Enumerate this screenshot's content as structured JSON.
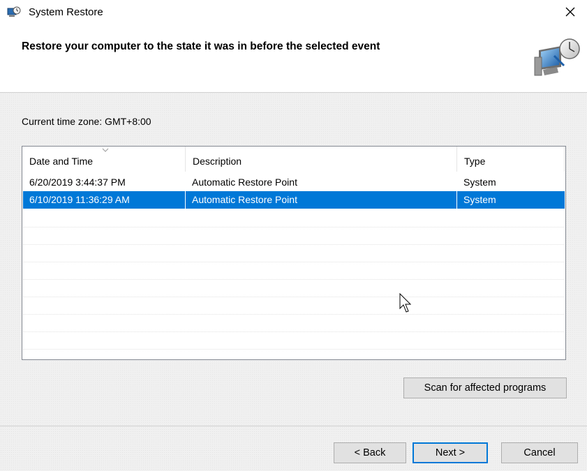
{
  "window": {
    "title": "System Restore",
    "close_glyph": "✕",
    "icons": {
      "app": "system-restore-icon",
      "close": "close-icon"
    }
  },
  "header": {
    "title": "Restore your computer to the state it was in before the selected event",
    "logo_icon": "system-restore-logo-icon"
  },
  "content": {
    "timezone_label": "Current time zone: GMT+8:00"
  },
  "restore_points": {
    "columns": [
      {
        "label": "Date and Time"
      },
      {
        "label": "Description"
      },
      {
        "label": "Type"
      }
    ],
    "sort_icon": "sort-chevron-down-icon",
    "rows": [
      {
        "date": "6/20/2019 3:44:37 PM",
        "description": "Automatic Restore Point",
        "type": "System",
        "selected": false
      },
      {
        "date": "6/10/2019 11:36:29 AM",
        "description": "Automatic Restore Point",
        "type": "System",
        "selected": true
      }
    ]
  },
  "buttons": {
    "scan": "Scan for affected programs",
    "back": "< Back",
    "next": "Next >",
    "cancel": "Cancel"
  },
  "colors": {
    "selection": "#0078d7",
    "button_face": "#e1e1e1",
    "button_border": "#adadad",
    "dialog_bg": "#f0f0f0"
  }
}
